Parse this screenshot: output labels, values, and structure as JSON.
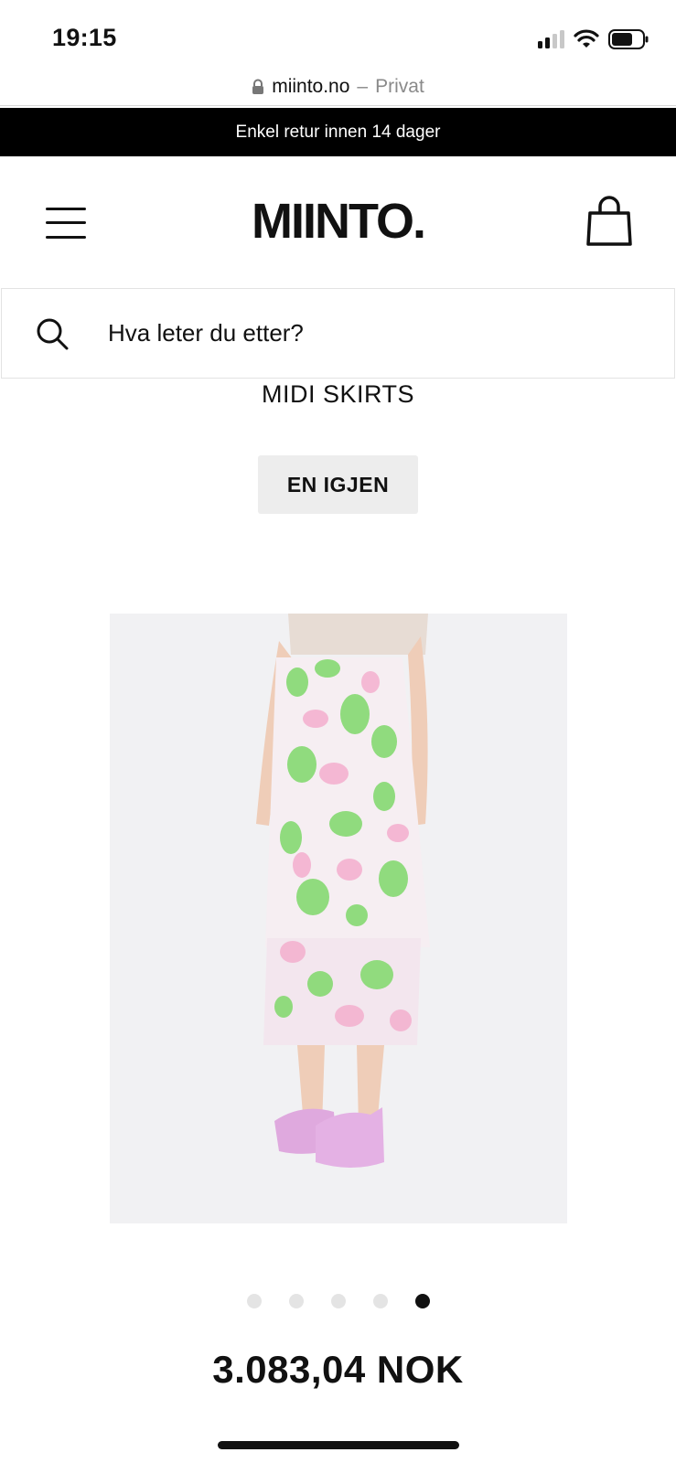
{
  "status_bar": {
    "time": "19:15"
  },
  "browser": {
    "domain": "miinto.no",
    "separator": "–",
    "mode": "Privat"
  },
  "promo": {
    "text": "Enkel retur innen 14 dager"
  },
  "header": {
    "logo": "MIINTO."
  },
  "search": {
    "placeholder": "Hva leter du etter?"
  },
  "product": {
    "category": "MIDI SKIRTS",
    "brand_button": "EN IGJEN",
    "price": "3.083,04 NOK",
    "image_count": 5,
    "active_image": 5
  },
  "icons": [
    "menu-icon",
    "shopping-bag-icon",
    "search-icon",
    "lock-icon",
    "wifi-icon",
    "battery-icon",
    "signal-icon"
  ]
}
